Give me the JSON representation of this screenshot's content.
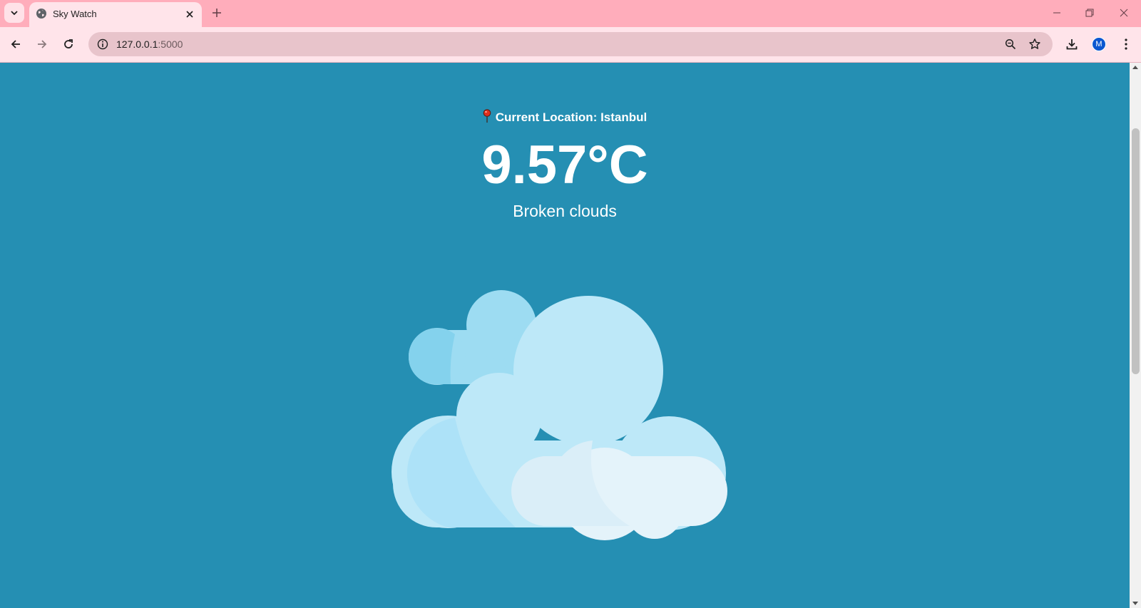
{
  "browser": {
    "tab": {
      "title": "Sky Watch",
      "favicon": "globe-icon"
    },
    "address_bar": {
      "host": "127.0.0.1",
      "port": ":5000"
    },
    "profile_initial": "M",
    "icons": {
      "tab_search": "chevron-down-icon",
      "tab_close": "close-icon",
      "new_tab": "plus-icon",
      "minimize": "minimize-icon",
      "restore": "restore-icon",
      "close_window": "close-icon",
      "back": "arrow-left-icon",
      "forward": "arrow-right-icon",
      "reload": "reload-icon",
      "site_info": "info-icon",
      "zoom": "zoom-icon",
      "bookmark": "star-icon",
      "download": "download-icon",
      "menu": "kebab-menu-icon"
    }
  },
  "weather": {
    "location_text": "Current Location: Istanbul",
    "temperature": "9.57°C",
    "description": "Broken clouds",
    "icon": "broken-clouds-icon"
  },
  "colors": {
    "page_background": "#258fb3",
    "tabstrip": "#ffadbb",
    "toolbar": "#ffe4ea",
    "omnibox": "#e8c4cb",
    "text": "#ffffff",
    "cloud_back": "#9ddcf2",
    "cloud_main": "#bde8f8",
    "cloud_front": "#e4f3fa"
  }
}
